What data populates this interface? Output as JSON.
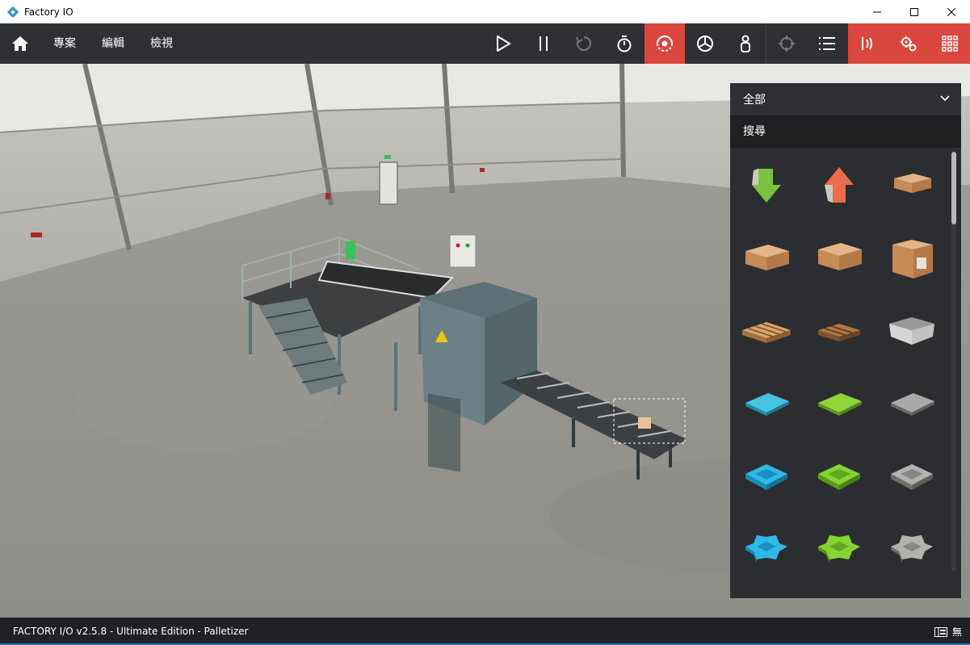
{
  "window": {
    "title": "Factory IO",
    "controls": [
      "minimize-icon",
      "maximize-icon",
      "close-icon"
    ]
  },
  "toolbar": {
    "menus": [
      "專案",
      "編輯",
      "檢視"
    ],
    "buttons": [
      {
        "id": "play",
        "icon": "play-icon"
      },
      {
        "id": "pause",
        "icon": "pause-icon"
      },
      {
        "id": "reset",
        "icon": "reset-icon"
      },
      {
        "id": "timer",
        "icon": "stopwatch-icon"
      },
      {
        "id": "camera-orbit",
        "icon": "orbit-camera-icon",
        "active": true
      },
      {
        "id": "camera-fly",
        "icon": "fly-camera-icon"
      },
      {
        "id": "camera-first-person",
        "icon": "first-person-icon"
      },
      {
        "id": "target",
        "icon": "crosshair-icon"
      },
      {
        "id": "list",
        "icon": "list-icon"
      },
      {
        "id": "sensors",
        "icon": "sensor-icon",
        "active": true
      },
      {
        "id": "drivers",
        "icon": "gears-icon",
        "active": true
      },
      {
        "id": "palette",
        "icon": "grid-icon",
        "active": true
      }
    ],
    "accent_color": "#d9473e"
  },
  "palette": {
    "category": "全部",
    "search_placeholder": "搜尋",
    "items": [
      "remover-arrow-down-icon",
      "emitter-arrow-up-icon",
      "small-box-icon",
      "medium-box-icon",
      "medium-box-2-icon",
      "large-box-icon",
      "pallet-light-icon",
      "pallet-dark-icon",
      "stackable-box-icon",
      "blue-raw-material-icon",
      "green-raw-material-icon",
      "metal-raw-material-icon",
      "blue-lid-icon",
      "green-lid-icon",
      "metal-lid-icon",
      "blue-base-icon",
      "green-base-icon",
      "metal-base-icon"
    ]
  },
  "status": {
    "text": "FACTORY I/O v2.5.8 - Ultimate Edition - Palletizer",
    "right_label": "無"
  }
}
